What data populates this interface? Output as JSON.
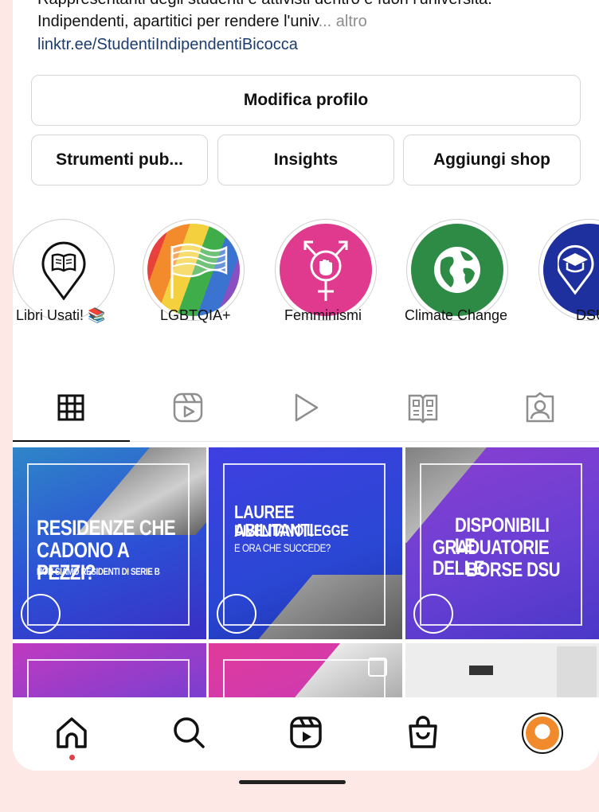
{
  "profile": {
    "bio_line1": "Rappresentanti degli studenti e attivisti dentro e fuori l'università.",
    "bio_line2": "Indipendenti, apartitici per rendere l'univ",
    "more_label": "... altro",
    "link": "linktr.ee/StudentiIndipendentiBicocca"
  },
  "buttons": {
    "edit_profile": "Modifica profilo",
    "tools": "Strumenti pub...",
    "insights": "Insights",
    "add_shop": "Aggiungi shop"
  },
  "highlights": [
    {
      "label": "Libri Usati! 📚",
      "icon": "book-pin-icon",
      "color": "#ffffff"
    },
    {
      "label": "LGBTQIA+",
      "icon": "rainbow-flag-icon",
      "color": "#e8403a"
    },
    {
      "label": "Femminismi",
      "icon": "feminism-symbol-icon",
      "color": "#e03a8f"
    },
    {
      "label": "Climate Change",
      "icon": "globe-icon",
      "color": "#2e8b45"
    },
    {
      "label": "DSU",
      "icon": "graduation-pin-icon",
      "color": "#1e2f9e"
    }
  ],
  "tabs": [
    {
      "name": "grid-icon"
    },
    {
      "name": "reels-icon"
    },
    {
      "name": "play-icon"
    },
    {
      "name": "guide-icon"
    },
    {
      "name": "tagged-icon"
    }
  ],
  "posts": [
    {
      "line1": "RESIDENZE CHE",
      "line2": "CADONO A PEZZI?",
      "sub": "NON SIAMO RESIDENTI DI SERIE B"
    },
    {
      "line1": "LAUREE ABILITANTI",
      "line2": "DIVENTANO LEGGE",
      "sub": "E ORA CHE SUCCEDE?"
    },
    {
      "line1": "DISPONIBILI LE",
      "line2": "GRADUATORIE DELLE",
      "line3": "BORSE DSU"
    }
  ],
  "colors": {
    "accent_blue": "#1c3c6e",
    "post_blue": "#2a47d4",
    "post_purple": "#7a3fd0",
    "post_magenta": "#c83ab8"
  },
  "nav": [
    {
      "name": "home-icon"
    },
    {
      "name": "search-icon"
    },
    {
      "name": "reels-icon"
    },
    {
      "name": "shop-icon"
    },
    {
      "name": "profile-avatar"
    }
  ]
}
